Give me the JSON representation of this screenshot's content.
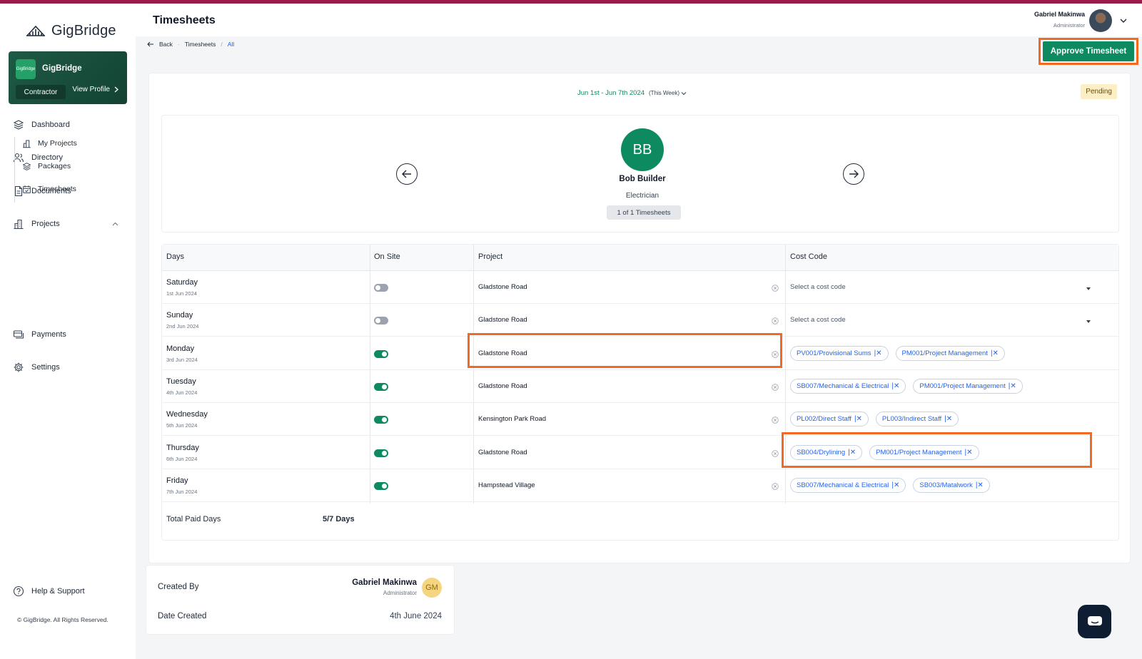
{
  "app": {
    "name": "GigBridge"
  },
  "org_card": {
    "logo_text": "GigBridge",
    "name": "GigBridge",
    "role": "Contractor",
    "view_profile": "View Profile"
  },
  "nav": {
    "dashboard": "Dashboard",
    "directory": "Directory",
    "documents": "Documents",
    "projects": "Projects",
    "my_projects": "My Projects",
    "packages": "Packages",
    "timesheets": "Timesheets",
    "payments": "Payments",
    "settings": "Settings",
    "help": "Help & Support"
  },
  "copyright": "© GigBridge. All Rights Reserved.",
  "header": {
    "title": "Timesheets",
    "user_name": "Gabriel Makinwa",
    "user_role": "Administrator"
  },
  "breadcrumb": {
    "back": "Back",
    "timesheets": "Timesheets",
    "sep": "/",
    "current": "All"
  },
  "approve_button": "Approve Timesheet",
  "period": {
    "range": "Jun 1st - Jun 7th 2024",
    "label": "(This Week)"
  },
  "status": "Pending",
  "worker": {
    "initials": "BB",
    "name": "Bob Builder",
    "role": "Electrician",
    "count": "1 of 1 Timesheets"
  },
  "table": {
    "headers": {
      "days": "Days",
      "on_site": "On Site",
      "project": "Project",
      "cost_code": "Cost Code"
    },
    "cost_placeholder": "Select a cost code",
    "rows": [
      {
        "day": "Saturday",
        "date": "1st Jun 2024",
        "on_site": false,
        "project": "Gladstone Road",
        "codes": []
      },
      {
        "day": "Sunday",
        "date": "2nd Jun 2024",
        "on_site": false,
        "project": "Gladstone Road",
        "codes": []
      },
      {
        "day": "Monday",
        "date": "3rd Jun 2024",
        "on_site": true,
        "project": "Gladstone Road",
        "codes": [
          "PV001/Provisional Sums",
          "PM001/Project Management"
        ]
      },
      {
        "day": "Tuesday",
        "date": "4th Jun 2024",
        "on_site": true,
        "project": "Gladstone Road",
        "codes": [
          "SB007/Mechanical & Electrical",
          "PM001/Project Management"
        ]
      },
      {
        "day": "Wednesday",
        "date": "5th Jun 2024",
        "on_site": true,
        "project": "Kensington Park Road",
        "codes": [
          "PL002/Direct Staff",
          "PL003/Indirect Staff"
        ]
      },
      {
        "day": "Thursday",
        "date": "6th Jun 2024",
        "on_site": true,
        "project": "Gladstone Road",
        "codes": [
          "SB004/Drylining",
          "PM001/Project Management"
        ]
      },
      {
        "day": "Friday",
        "date": "7th Jun 2024",
        "on_site": true,
        "project": "Hampstead Village",
        "codes": [
          "SB007/Mechanical & Electrical",
          "SB003/Matalwork"
        ]
      }
    ],
    "total_label": "Total Paid Days",
    "total_value": "5/7 Days"
  },
  "meta": {
    "created_by_label": "Created By",
    "creator_name": "Gabriel Makinwa",
    "creator_role": "Administrator",
    "creator_initials": "GM",
    "date_created_label": "Date Created",
    "date_created": "4th June 2024"
  },
  "colors": {
    "accent": "#0d8a5f",
    "highlight": "#f26a21",
    "brand_bar": "#9b1b4b",
    "chip_text": "#2563eb"
  }
}
